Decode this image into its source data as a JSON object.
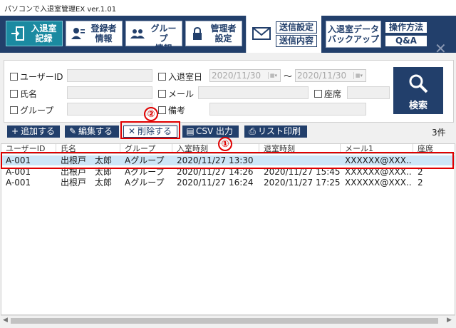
{
  "window": {
    "title": "パソコンで入退室管理EX ver.1.01"
  },
  "toolbar": {
    "entry_record": "入退室\n記録",
    "register_info": "登録者\n情報",
    "group_info": "グループ\n情報",
    "admin_settings": "管理者\n設定",
    "send_settings": "送信設定",
    "send_content": "送信内容",
    "backup": "入退室データ\nバックアップ",
    "how_to": "操作方法",
    "qa": "Q&A",
    "close": "✕"
  },
  "search": {
    "user_id_label": "ユーザーID",
    "name_label": "氏名",
    "group_label": "グループ",
    "entry_date_label": "入退室日",
    "date_from": "2020/11/30",
    "tilde": "〜",
    "date_to": "2020/11/30",
    "email_label": "メール",
    "remarks_label": "備考",
    "seat_label": "座席",
    "search_button": "検索"
  },
  "actions": {
    "add": "追加する",
    "edit": "編集する",
    "delete": "削除する",
    "csv": "CSV 出力",
    "print": "リスト印刷",
    "count": "3件"
  },
  "table": {
    "columns": [
      "ユーザーID",
      "氏名",
      "グループ",
      "入室時刻",
      "退室時刻",
      "メール1",
      "座席"
    ],
    "rows": [
      {
        "user_id": "A-001",
        "name": "出根戸　太郎",
        "group": "Aグループ",
        "entry": "2020/11/27 13:30",
        "exit": "",
        "mail": "XXXXXX@XXX...",
        "seat": ""
      },
      {
        "user_id": "A-001",
        "name": "出根戸　太郎",
        "group": "Aグループ",
        "entry": "2020/11/27 14:26",
        "exit": "2020/11/27 15:45",
        "mail": "XXXXXX@XXX...",
        "seat": "2"
      },
      {
        "user_id": "A-001",
        "name": "出根戸　太郎",
        "group": "Aグループ",
        "entry": "2020/11/27 16:24",
        "exit": "2020/11/27 17:25",
        "mail": "XXXXXX@XXX...",
        "seat": "2"
      }
    ]
  },
  "annotations": {
    "callout_1": "①",
    "callout_2": "②"
  },
  "colors": {
    "navy": "#223f6b",
    "accent": "#1b8aa1",
    "highlight": "#e00000",
    "selected_row": "#cde6f7"
  }
}
